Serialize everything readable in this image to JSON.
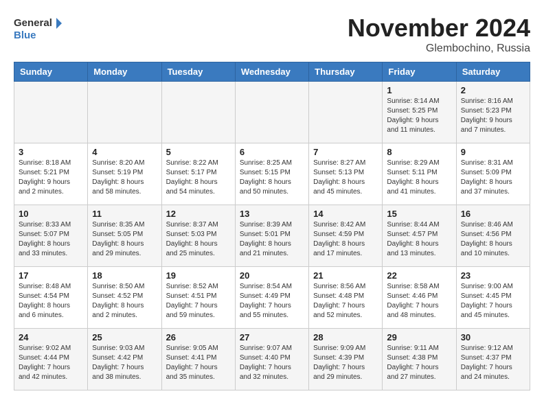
{
  "header": {
    "logo_line1": "General",
    "logo_line2": "Blue",
    "month_title": "November 2024",
    "location": "Glembochino, Russia"
  },
  "weekdays": [
    "Sunday",
    "Monday",
    "Tuesday",
    "Wednesday",
    "Thursday",
    "Friday",
    "Saturday"
  ],
  "weeks": [
    [
      {
        "day": "",
        "info": ""
      },
      {
        "day": "",
        "info": ""
      },
      {
        "day": "",
        "info": ""
      },
      {
        "day": "",
        "info": ""
      },
      {
        "day": "",
        "info": ""
      },
      {
        "day": "1",
        "info": "Sunrise: 8:14 AM\nSunset: 5:25 PM\nDaylight: 9 hours and 11 minutes."
      },
      {
        "day": "2",
        "info": "Sunrise: 8:16 AM\nSunset: 5:23 PM\nDaylight: 9 hours and 7 minutes."
      }
    ],
    [
      {
        "day": "3",
        "info": "Sunrise: 8:18 AM\nSunset: 5:21 PM\nDaylight: 9 hours and 2 minutes."
      },
      {
        "day": "4",
        "info": "Sunrise: 8:20 AM\nSunset: 5:19 PM\nDaylight: 8 hours and 58 minutes."
      },
      {
        "day": "5",
        "info": "Sunrise: 8:22 AM\nSunset: 5:17 PM\nDaylight: 8 hours and 54 minutes."
      },
      {
        "day": "6",
        "info": "Sunrise: 8:25 AM\nSunset: 5:15 PM\nDaylight: 8 hours and 50 minutes."
      },
      {
        "day": "7",
        "info": "Sunrise: 8:27 AM\nSunset: 5:13 PM\nDaylight: 8 hours and 45 minutes."
      },
      {
        "day": "8",
        "info": "Sunrise: 8:29 AM\nSunset: 5:11 PM\nDaylight: 8 hours and 41 minutes."
      },
      {
        "day": "9",
        "info": "Sunrise: 8:31 AM\nSunset: 5:09 PM\nDaylight: 8 hours and 37 minutes."
      }
    ],
    [
      {
        "day": "10",
        "info": "Sunrise: 8:33 AM\nSunset: 5:07 PM\nDaylight: 8 hours and 33 minutes."
      },
      {
        "day": "11",
        "info": "Sunrise: 8:35 AM\nSunset: 5:05 PM\nDaylight: 8 hours and 29 minutes."
      },
      {
        "day": "12",
        "info": "Sunrise: 8:37 AM\nSunset: 5:03 PM\nDaylight: 8 hours and 25 minutes."
      },
      {
        "day": "13",
        "info": "Sunrise: 8:39 AM\nSunset: 5:01 PM\nDaylight: 8 hours and 21 minutes."
      },
      {
        "day": "14",
        "info": "Sunrise: 8:42 AM\nSunset: 4:59 PM\nDaylight: 8 hours and 17 minutes."
      },
      {
        "day": "15",
        "info": "Sunrise: 8:44 AM\nSunset: 4:57 PM\nDaylight: 8 hours and 13 minutes."
      },
      {
        "day": "16",
        "info": "Sunrise: 8:46 AM\nSunset: 4:56 PM\nDaylight: 8 hours and 10 minutes."
      }
    ],
    [
      {
        "day": "17",
        "info": "Sunrise: 8:48 AM\nSunset: 4:54 PM\nDaylight: 8 hours and 6 minutes."
      },
      {
        "day": "18",
        "info": "Sunrise: 8:50 AM\nSunset: 4:52 PM\nDaylight: 8 hours and 2 minutes."
      },
      {
        "day": "19",
        "info": "Sunrise: 8:52 AM\nSunset: 4:51 PM\nDaylight: 7 hours and 59 minutes."
      },
      {
        "day": "20",
        "info": "Sunrise: 8:54 AM\nSunset: 4:49 PM\nDaylight: 7 hours and 55 minutes."
      },
      {
        "day": "21",
        "info": "Sunrise: 8:56 AM\nSunset: 4:48 PM\nDaylight: 7 hours and 52 minutes."
      },
      {
        "day": "22",
        "info": "Sunrise: 8:58 AM\nSunset: 4:46 PM\nDaylight: 7 hours and 48 minutes."
      },
      {
        "day": "23",
        "info": "Sunrise: 9:00 AM\nSunset: 4:45 PM\nDaylight: 7 hours and 45 minutes."
      }
    ],
    [
      {
        "day": "24",
        "info": "Sunrise: 9:02 AM\nSunset: 4:44 PM\nDaylight: 7 hours and 42 minutes."
      },
      {
        "day": "25",
        "info": "Sunrise: 9:03 AM\nSunset: 4:42 PM\nDaylight: 7 hours and 38 minutes."
      },
      {
        "day": "26",
        "info": "Sunrise: 9:05 AM\nSunset: 4:41 PM\nDaylight: 7 hours and 35 minutes."
      },
      {
        "day": "27",
        "info": "Sunrise: 9:07 AM\nSunset: 4:40 PM\nDaylight: 7 hours and 32 minutes."
      },
      {
        "day": "28",
        "info": "Sunrise: 9:09 AM\nSunset: 4:39 PM\nDaylight: 7 hours and 29 minutes."
      },
      {
        "day": "29",
        "info": "Sunrise: 9:11 AM\nSunset: 4:38 PM\nDaylight: 7 hours and 27 minutes."
      },
      {
        "day": "30",
        "info": "Sunrise: 9:12 AM\nSunset: 4:37 PM\nDaylight: 7 hours and 24 minutes."
      }
    ]
  ]
}
